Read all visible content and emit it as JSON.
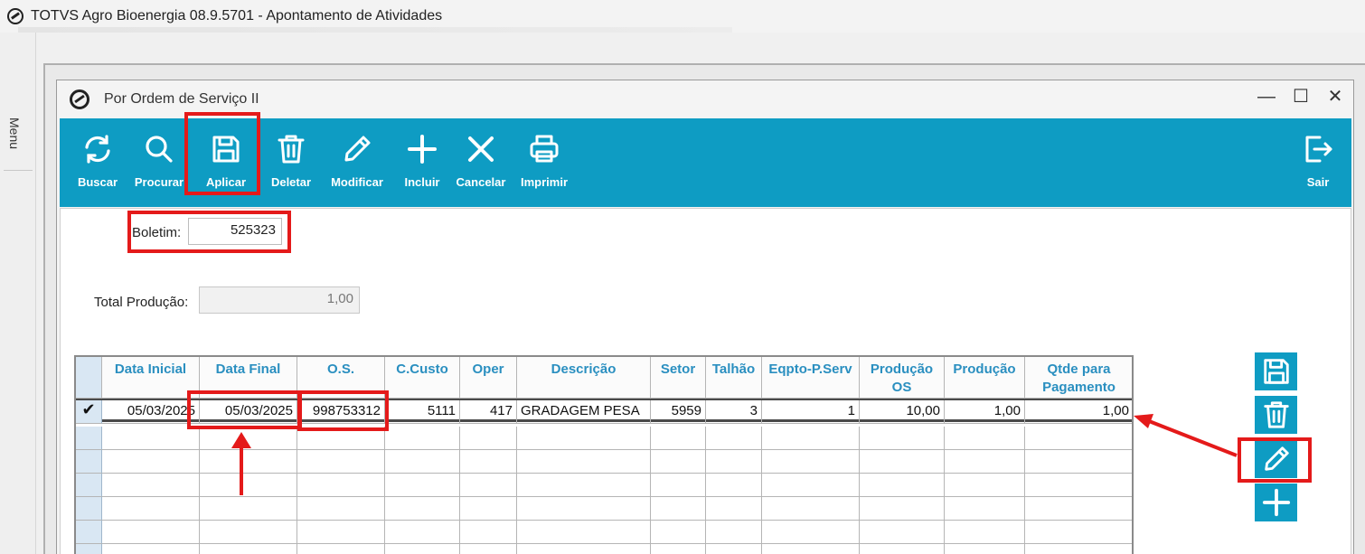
{
  "app": {
    "title": "TOTVS Agro Bioenergia 08.9.5701 - Apontamento de Atividades"
  },
  "menu": {
    "label": "Menu"
  },
  "window": {
    "title": "Por Ordem de Serviço II",
    "controls": {
      "minimize": "—",
      "maximize": "☐",
      "close": "✕"
    }
  },
  "toolbar": {
    "buscar": "Buscar",
    "procurar": "Procurar",
    "aplicar": "Aplicar",
    "deletar": "Deletar",
    "modificar": "Modificar",
    "incluir": "Incluir",
    "cancelar": "Cancelar",
    "imprimir": "Imprimir",
    "sair": "Sair"
  },
  "form": {
    "boletim_label": "Boletim:",
    "boletim_value": "525323",
    "total_producao_label": "Total Produção:",
    "total_producao_value": "1,00"
  },
  "grid": {
    "headers": [
      "Data Inicial",
      "Data Final",
      "O.S.",
      "C.Custo",
      "Oper",
      "Descrição",
      "Setor",
      "Talhão",
      "Eqpto-P.Serv",
      "Produção OS",
      "Produção",
      "Qtde para Pagamento"
    ],
    "rows": [
      {
        "marker": "✔",
        "data_inicial": "05/03/2025",
        "data_final": "05/03/2025",
        "os": "998753312",
        "ccusto": "5111",
        "oper": "417",
        "descricao": "GRADAGEM PESA",
        "setor": "5959",
        "talhao": "3",
        "eqpto": "1",
        "producao_os": "10,00",
        "producao": "1,00",
        "qtde_pagamento": "1,00"
      }
    ]
  },
  "side_actions": [
    "save-icon",
    "trash-icon",
    "pencil-icon",
    "plus-icon"
  ],
  "colors": {
    "toolbar": "#0e9cc3",
    "header_text": "#2a8fc0",
    "annotation": "#e41a1a"
  }
}
